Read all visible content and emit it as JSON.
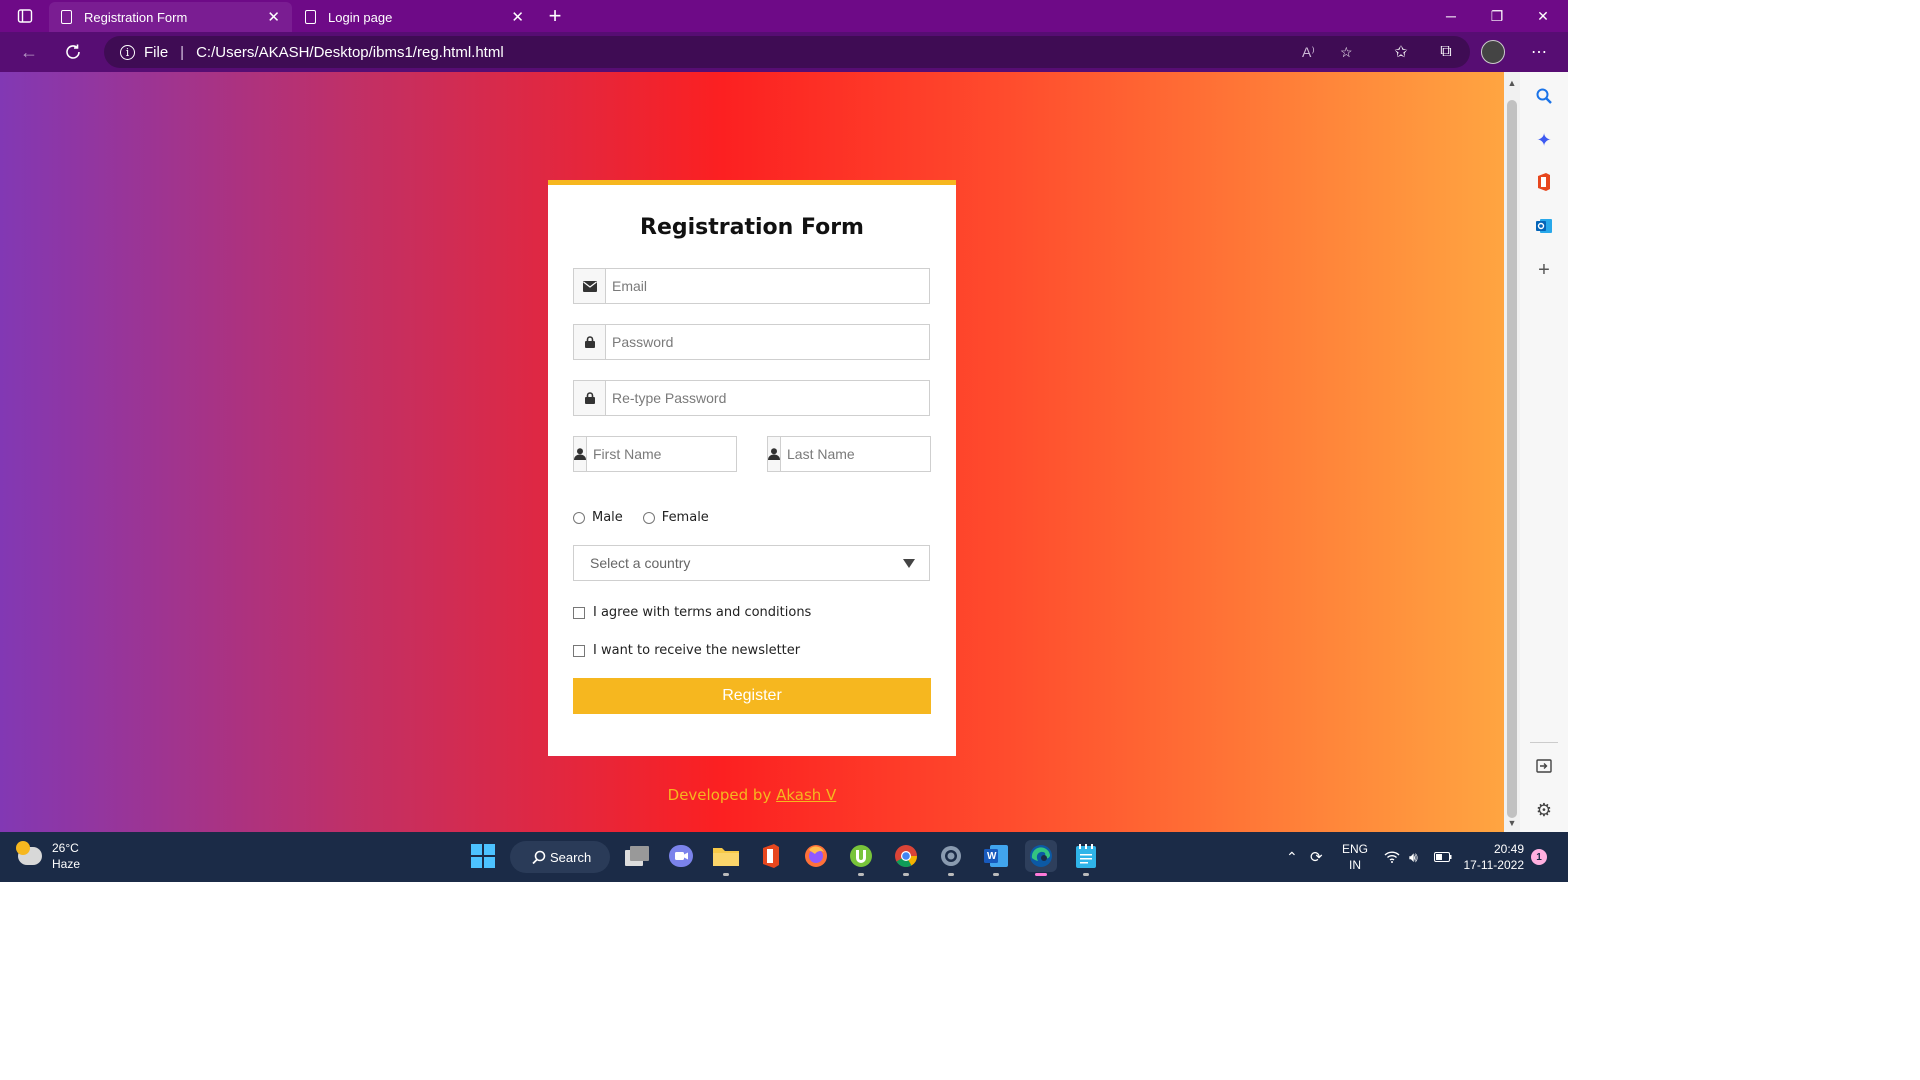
{
  "browser": {
    "tabs": [
      {
        "label": "Registration Form",
        "active": true
      },
      {
        "label": "Login page",
        "active": false
      }
    ],
    "new_tab_glyph": "+",
    "address": {
      "prefix": "File",
      "url": "C:/Users/AKASH/Desktop/ibms1/reg.html.html",
      "read_aloud_glyph": "A⁾"
    }
  },
  "form": {
    "title": "Registration Form",
    "email_placeholder": "Email",
    "password_placeholder": "Password",
    "retype_placeholder": "Re-type Password",
    "first_name_placeholder": "First Name",
    "last_name_placeholder": "Last Name",
    "gender_options": [
      "Male",
      "Female"
    ],
    "country_placeholder": "Select a country",
    "terms_label": "I agree with terms and conditions",
    "newsletter_label": "I want to receive the newsletter",
    "register_label": "Register"
  },
  "footer": {
    "prefix": "Developed by ",
    "author": "Akash V"
  },
  "taskbar": {
    "weather_temp": "26°C",
    "weather_desc": "Haze",
    "search_label": "Search",
    "word_label": "W",
    "language_top": "ENG",
    "language_bottom": "IN",
    "time": "20:49",
    "date": "17-11-2022",
    "notification_count": "1"
  },
  "colors": {
    "accent": "#f6b71f",
    "titlebar": "#6e0a87",
    "addressbar": "#570d73"
  }
}
